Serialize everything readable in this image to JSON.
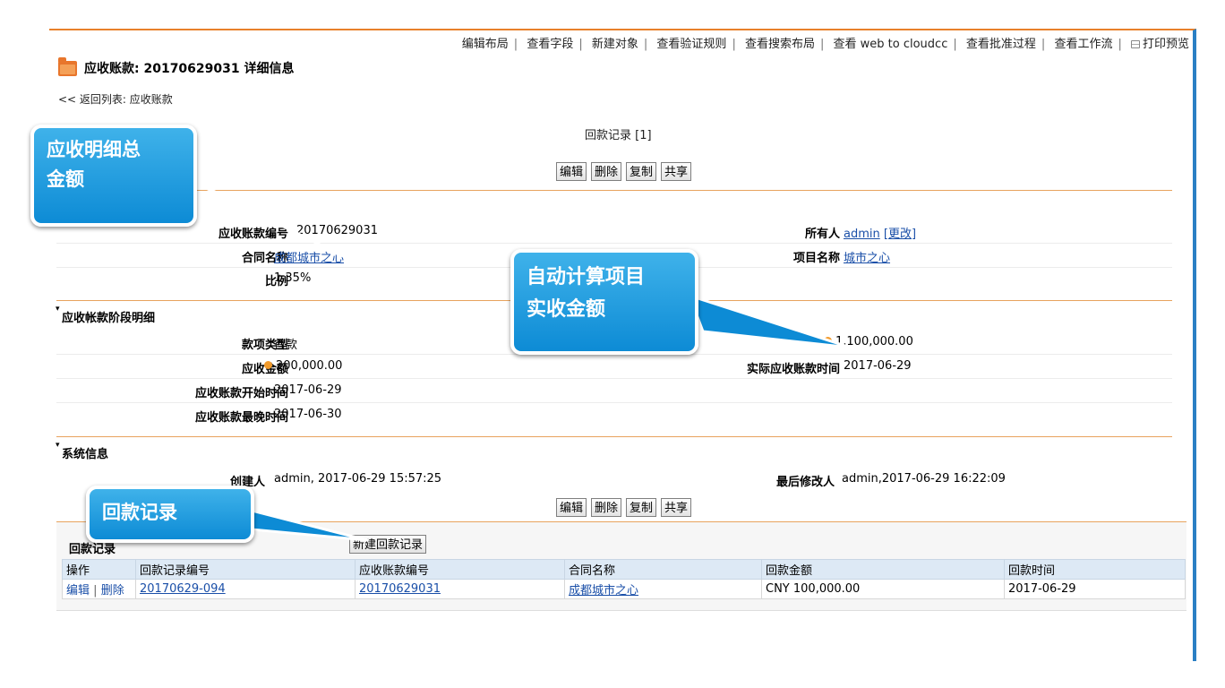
{
  "topnav": {
    "items": [
      "编辑布局",
      "查看字段",
      "新建对象",
      "查看验证规则",
      "查看搜索布局",
      "查看 web to cloudcc",
      "查看批准过程",
      "查看工作流"
    ],
    "print": "打印预览"
  },
  "page": {
    "title": "应收账款: 20170629031 详细信息",
    "back": "<< 返回列表: 应收账款",
    "related_link": "回款记录 [1]"
  },
  "buttons": {
    "edit": "编辑",
    "delete": "删除",
    "copy": "复制",
    "share": "共享"
  },
  "detail": {
    "ar_no_label": "应收账款编号",
    "ar_no": "20170629031",
    "contract_label": "合同名称",
    "contract": "成都城市之心",
    "ratio_label": "比例",
    "ratio": "1.35%",
    "owner_label": "所有人",
    "owner": "admin",
    "owner_change": "[更改]",
    "project_label": "项目名称",
    "project": "城市之心"
  },
  "stage": {
    "section": "应收帐款阶段明细",
    "type_label": "款项类型",
    "type": "首款",
    "amount_label": "应收金额",
    "amount": "200,000.00",
    "start_label": "应收账款开始时间",
    "start": "2017-06-29",
    "end_label": "应收账款最晚时间",
    "end": "2017-06-30",
    "actual_amount": "1,100,000.00",
    "actual_time_label": "实际应收账款时间",
    "actual_time": "2017-06-29"
  },
  "system": {
    "section": "系统信息",
    "creator_label": "创建人",
    "creator": "admin, 2017-06-29 15:57:25",
    "modifier_label": "最后修改人",
    "modifier": "admin,2017-06-29 16:22:09"
  },
  "related": {
    "title": "回款记录",
    "new_button": "新建回款记录",
    "columns": [
      "操作",
      "回款记录编号",
      "应收账款编号",
      "合同名称",
      "回款金额",
      "回款时间"
    ],
    "row": {
      "edit": "编辑",
      "delete": "删除",
      "record_no": "20170629-094",
      "ar_no": "20170629031",
      "contract": "成都城市之心",
      "amount": "CNY 100,000.00",
      "date": "2017-06-29"
    }
  },
  "callouts": {
    "detail_total": "应收明细总\n金额",
    "auto_calc": "自动计算项目\n实收金额",
    "payment_records": "回款记录"
  }
}
